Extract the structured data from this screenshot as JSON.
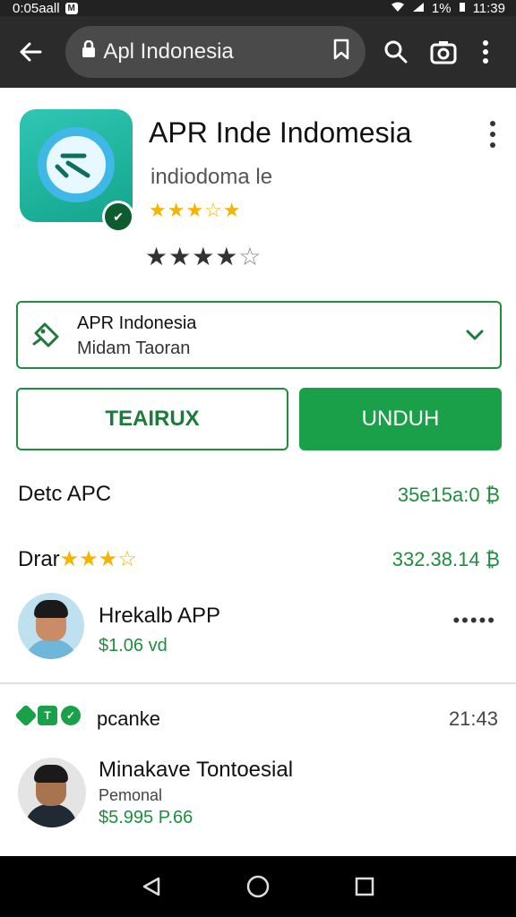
{
  "status_bar": {
    "left_text": "0:05aall",
    "badge": "M",
    "battery": "1%",
    "time": "11:39"
  },
  "browser": {
    "url": "Apl Indonesia",
    "icons": [
      "back-arrow-icon",
      "lock-icon",
      "bookmark-icon",
      "search-icon",
      "camera-icon",
      "more-vertical-icon"
    ]
  },
  "app": {
    "title": "APR Inde Indomesia",
    "developer": "indiodoma le",
    "rating_gold": {
      "filled": 4,
      "total": 5
    },
    "rating_dark": {
      "filled": 4,
      "total": 5
    }
  },
  "selector": {
    "title": "APR Indonesia",
    "subtitle": "Midam Taoran"
  },
  "buttons": {
    "secondary": "TEAIRUX",
    "primary": "UNDUH"
  },
  "info_rows": [
    {
      "label": "Detc APC",
      "value": "35e15a:0 ₿"
    },
    {
      "label": "Drar",
      "stars": "★★★☆",
      "value": "332.38.14 ₿"
    }
  ],
  "reviews": [
    {
      "name": "Hrekalb APP",
      "price": "$1.06 vd",
      "more": "•••••"
    },
    {
      "name": "Minakave Tontoesial",
      "role": "Pemonal",
      "price": "$5.995 P.66"
    }
  ],
  "tags_row": {
    "label": "pcanke",
    "time": "21:43"
  },
  "colors": {
    "accent": "#1aa049",
    "toolbar": "#2b2b2b",
    "star": "#f4b400"
  }
}
